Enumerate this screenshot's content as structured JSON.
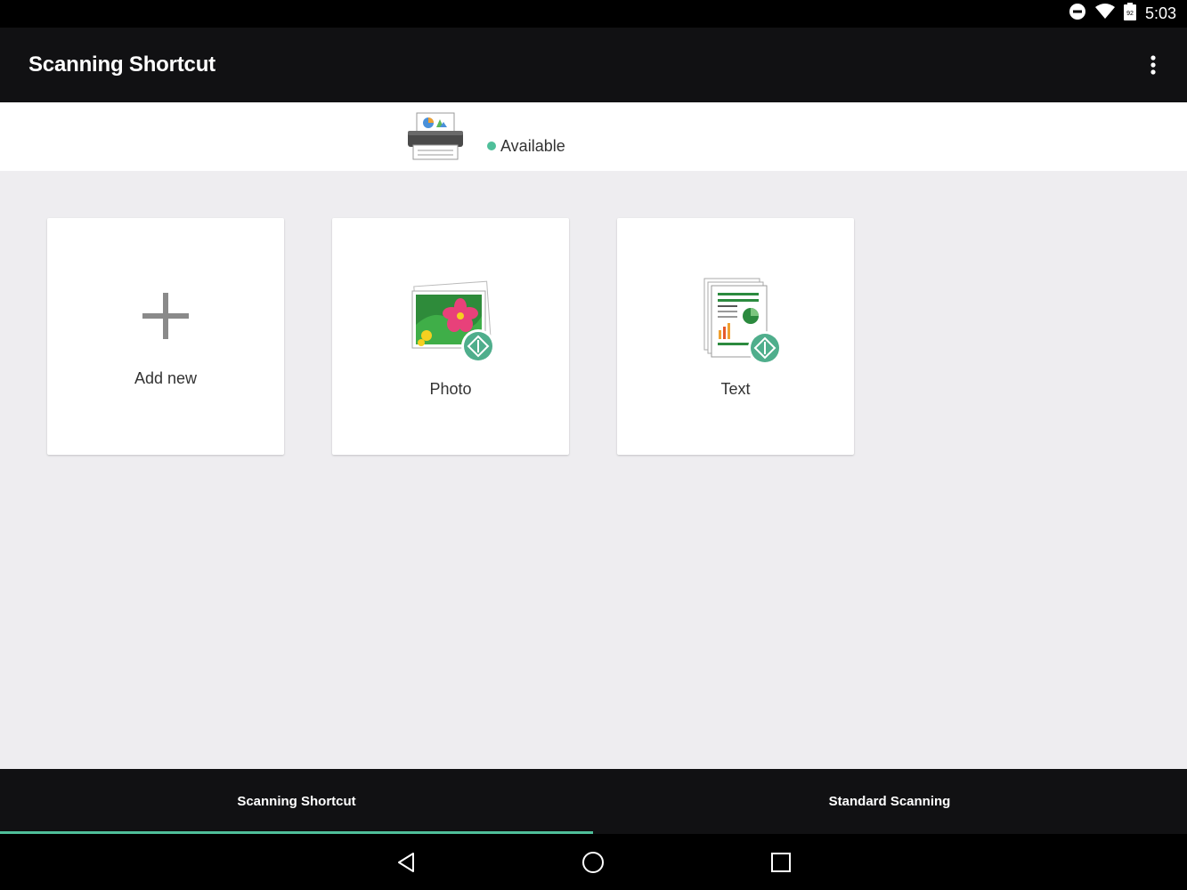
{
  "status_bar": {
    "time": "5:03",
    "battery_level": "92"
  },
  "app_bar": {
    "title": "Scanning Shortcut",
    "menu_icon": "more-vert-icon"
  },
  "device": {
    "status": "Available",
    "status_color": "#4fbf9a",
    "icon": "printer-scanner-icon"
  },
  "tiles": [
    {
      "label": "Add new",
      "icon": "plus-icon"
    },
    {
      "label": "Photo",
      "icon": "photo-scan-icon"
    },
    {
      "label": "Text",
      "icon": "document-scan-icon"
    }
  ],
  "bottom_tabs": [
    {
      "label": "Scanning Shortcut",
      "selected": true
    },
    {
      "label": "Standard Scanning",
      "selected": false
    }
  ],
  "accent_color": "#4fbf9a"
}
